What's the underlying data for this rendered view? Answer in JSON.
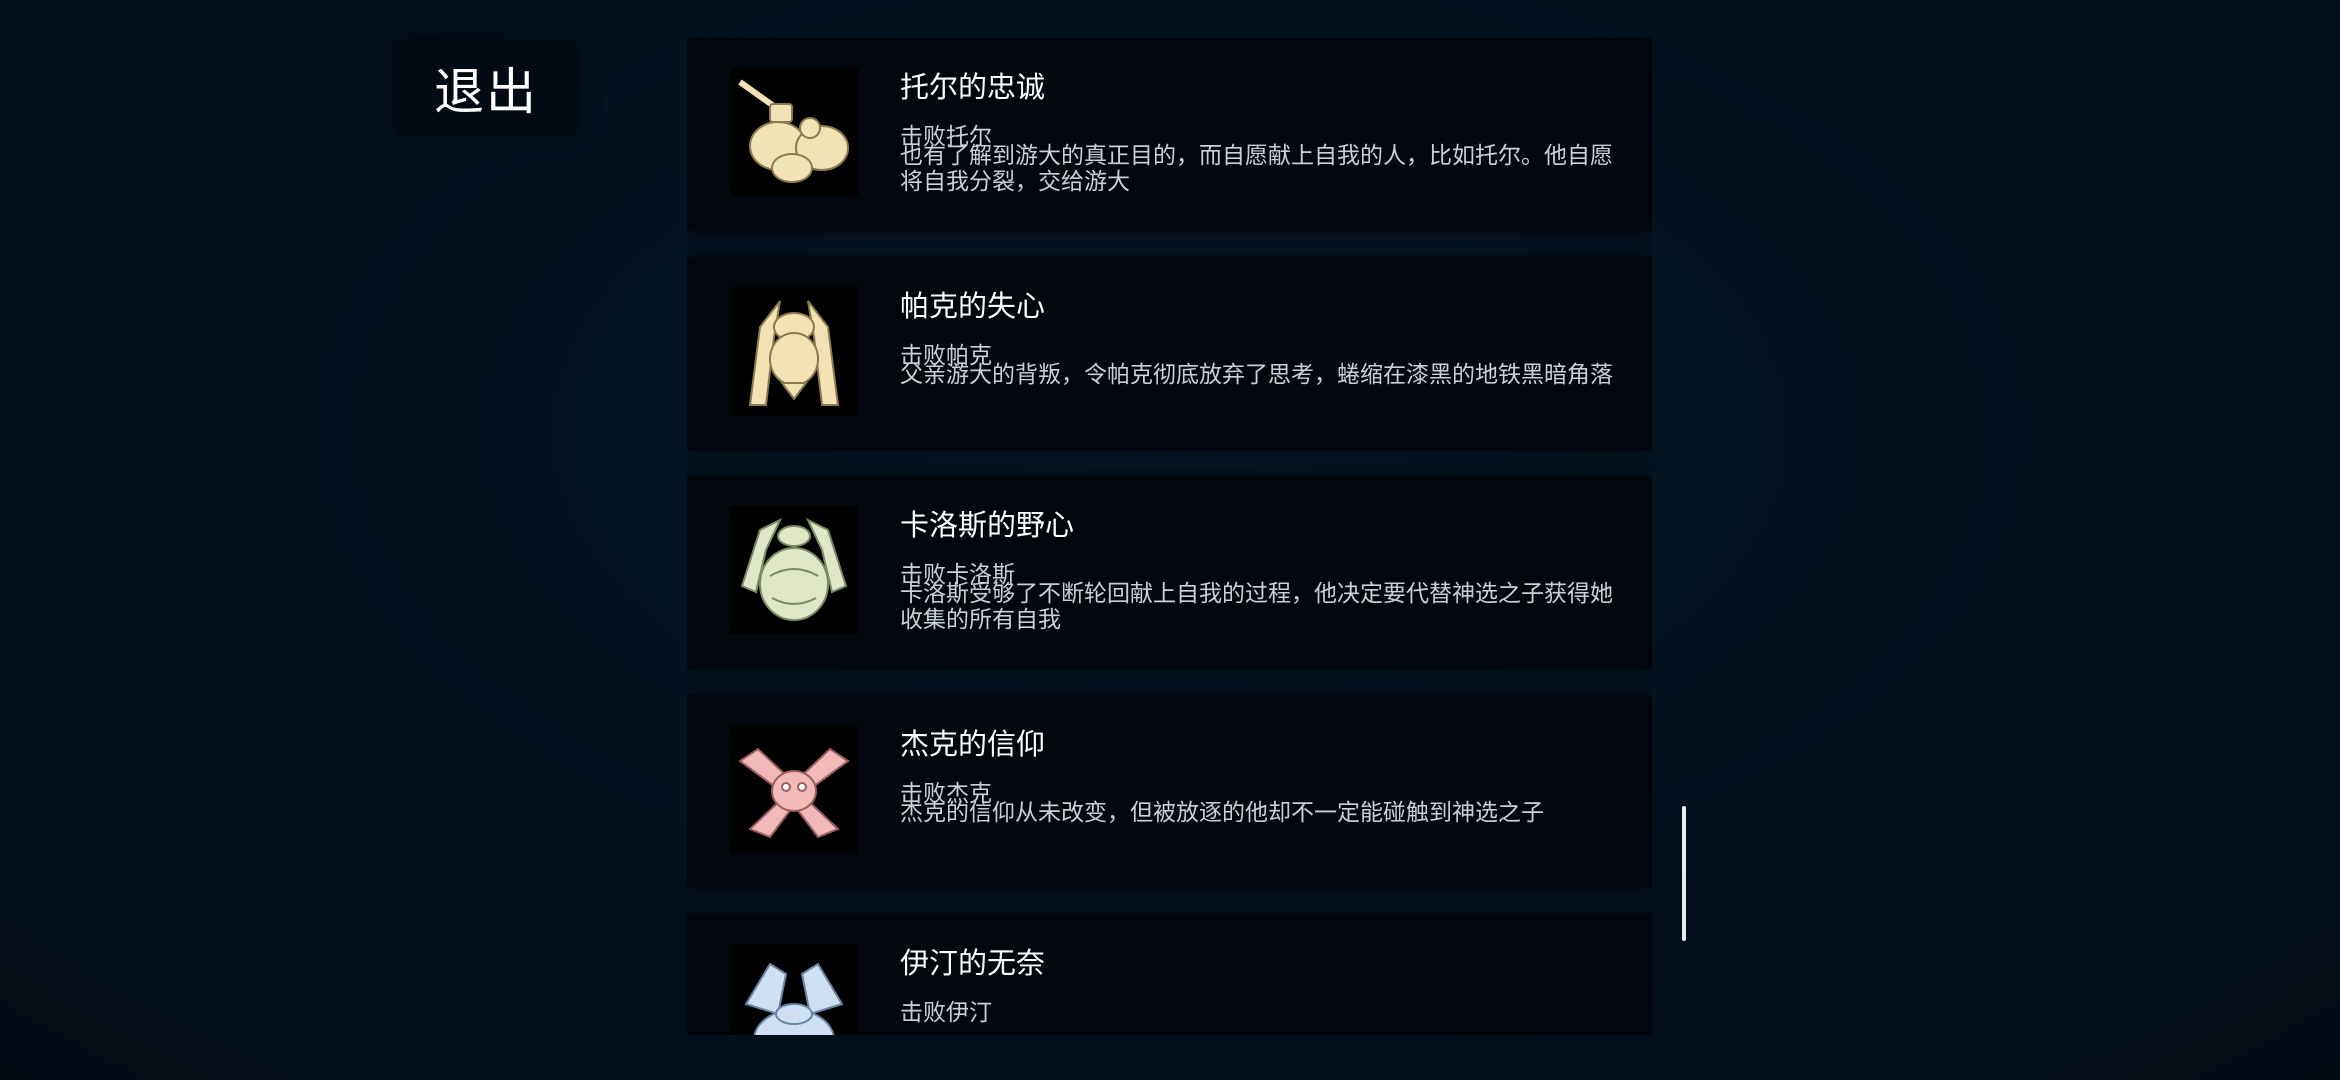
{
  "exit_label": "退出",
  "achievements": [
    {
      "title": "托尔的忠诚",
      "subtitle": "击败托尔",
      "description": "也有了解到游大的真正目的，而自愿献上自我的人，比如托尔。他自愿将自我分裂，交给游大",
      "icon": "tor-portrait-icon",
      "color": "#f1e3b6"
    },
    {
      "title": "帕克的失心",
      "subtitle": "击败帕克",
      "description": "父亲游大的背叛，令帕克彻底放弃了思考，蜷缩在漆黑的地铁黑暗角落",
      "icon": "park-portrait-icon",
      "color": "#f3e2b4"
    },
    {
      "title": "卡洛斯的野心",
      "subtitle": "击败卡洛斯",
      "description": "卡洛斯受够了不断轮回献上自我的过程，他决定要代替神选之子获得她收集的所有自我",
      "icon": "carlos-portrait-icon",
      "color": "#dfe7c8"
    },
    {
      "title": "杰克的信仰",
      "subtitle": "击败杰克",
      "description": "杰克的信仰从未改变，但被放逐的他却不一定能碰触到神选之子",
      "icon": "jack-portrait-icon",
      "color": "#f2b9b9"
    },
    {
      "title": "伊汀的无奈",
      "subtitle": "击败伊汀",
      "description": "",
      "icon": "iting-portrait-icon",
      "color": "#cfe0f3"
    }
  ]
}
